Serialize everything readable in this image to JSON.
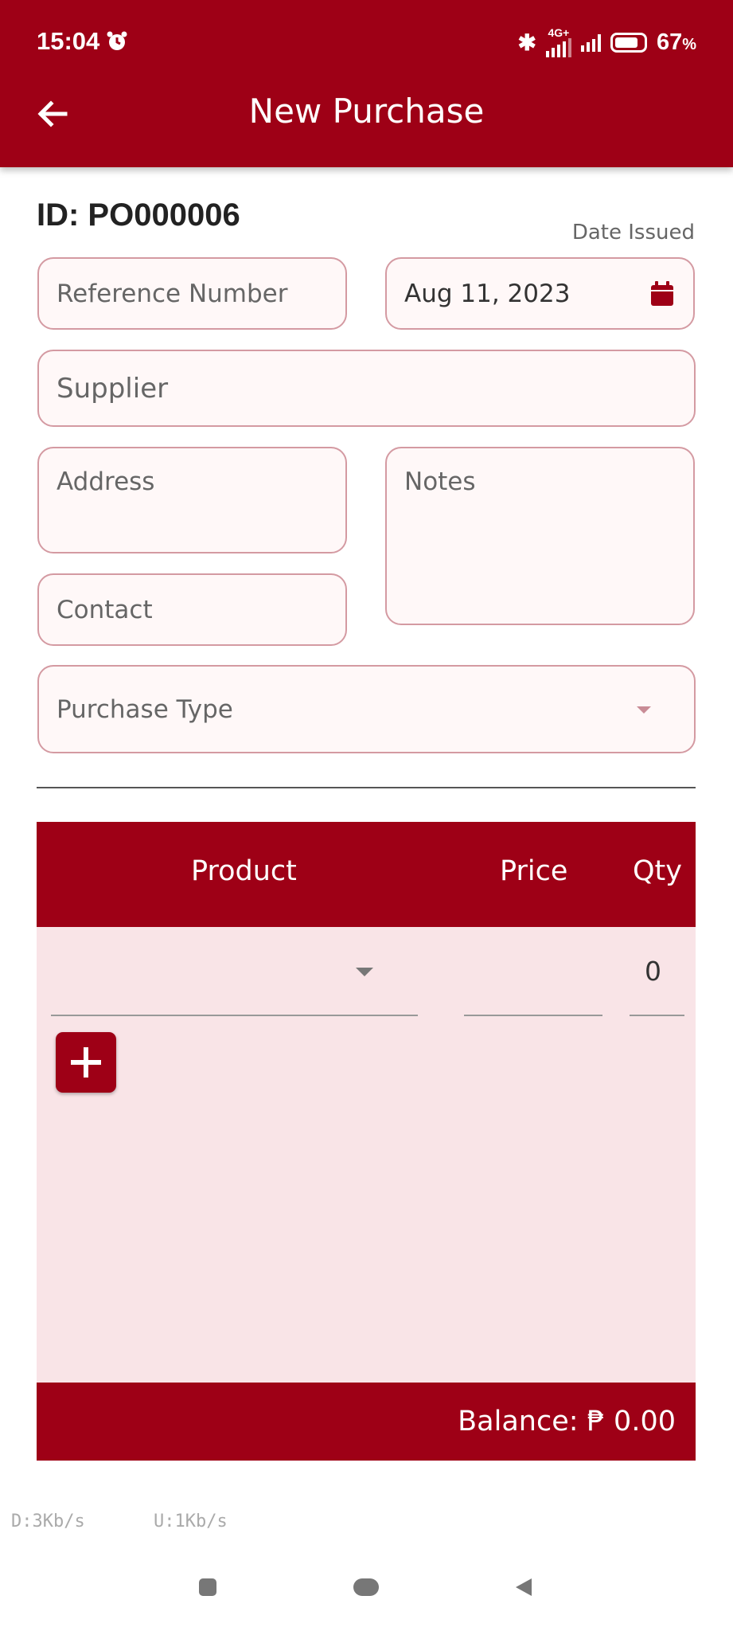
{
  "status_bar": {
    "time": "15:04",
    "network": "4G+",
    "battery": "67",
    "battery_unit": "%"
  },
  "header": {
    "title": "New Purchase"
  },
  "form": {
    "id_label": "ID: PO000006",
    "date_issued_label": "Date Issued",
    "reference_placeholder": "Reference Number",
    "date_value": "Aug 11, 2023",
    "supplier_placeholder": "Supplier",
    "address_placeholder": "Address",
    "notes_placeholder": "Notes",
    "contact_placeholder": "Contact",
    "purchase_type_placeholder": "Purchase Type"
  },
  "table": {
    "columns": [
      "Product",
      "Price",
      "Qty"
    ],
    "rows": [
      {
        "product": "",
        "price": "",
        "qty": "0"
      }
    ]
  },
  "footer": {
    "balance_label": "Balance: ₱ 0.00"
  },
  "speed": {
    "download": "D:3Kb/s",
    "upload": "U:1Kb/s"
  },
  "colors": {
    "primary": "#9e0016",
    "field_border": "#d49aa2",
    "table_body": "#f9e4e7"
  },
  "icons": [
    "alarm-icon",
    "bluetooth-icon",
    "signal-icon",
    "battery-icon",
    "back-arrow-icon",
    "calendar-icon",
    "dropdown-icon",
    "add-icon"
  ]
}
